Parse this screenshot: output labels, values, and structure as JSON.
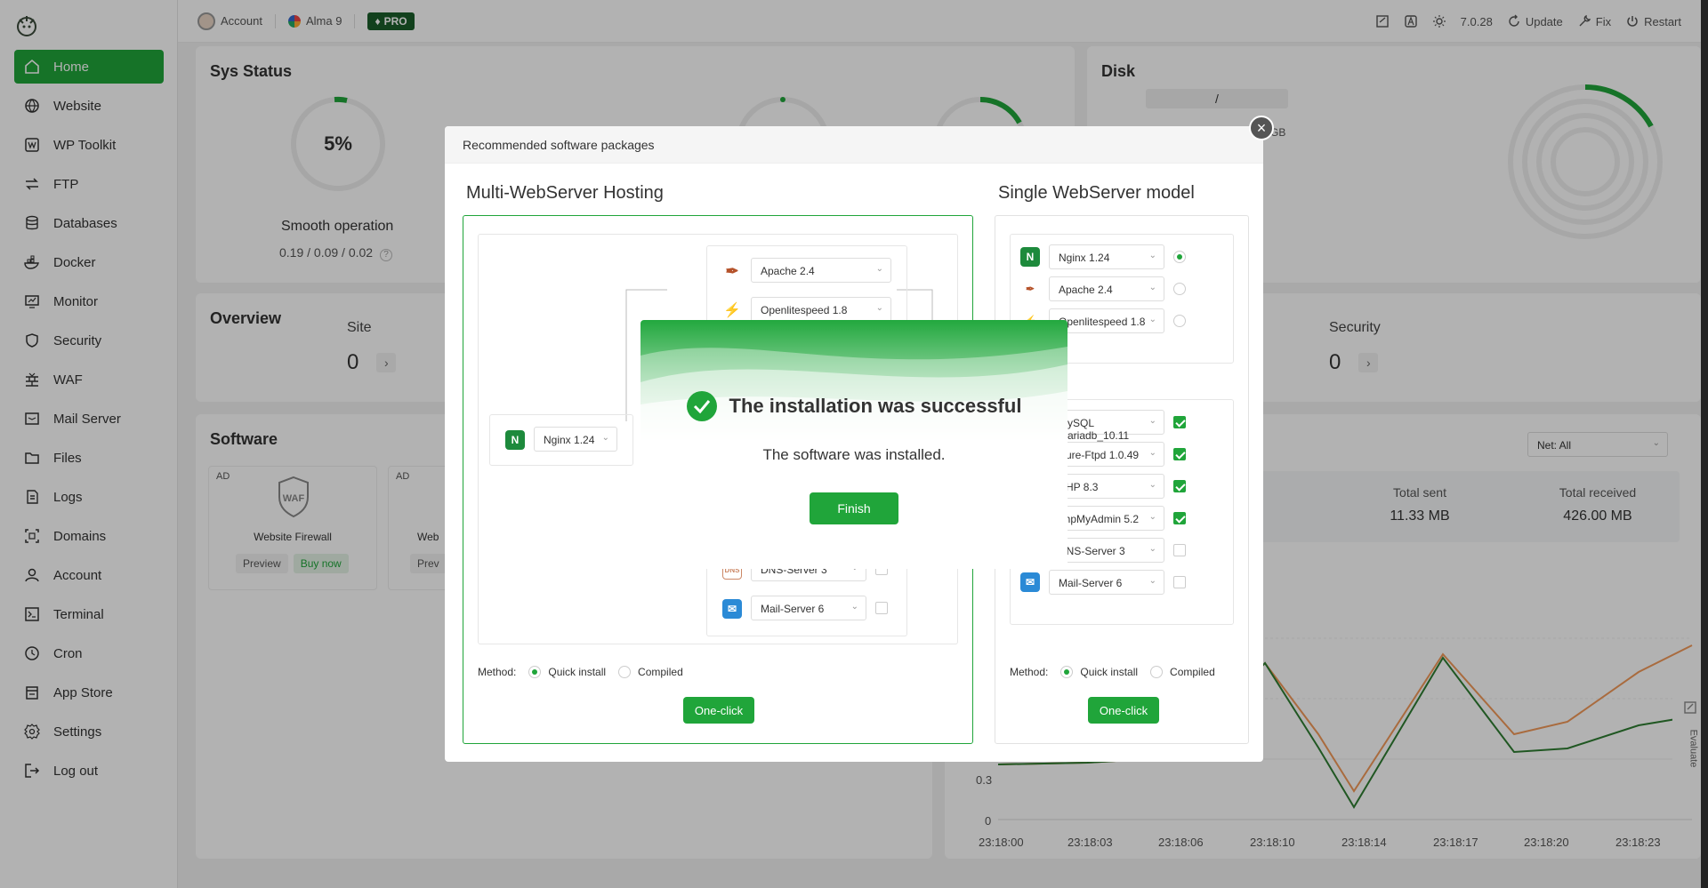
{
  "sidebar": {
    "items": [
      {
        "label": "Home",
        "icon": "home-icon",
        "active": true
      },
      {
        "label": "Website",
        "icon": "globe-icon"
      },
      {
        "label": "WP Toolkit",
        "icon": "wordpress-icon"
      },
      {
        "label": "FTP",
        "icon": "ftp-icon"
      },
      {
        "label": "Databases",
        "icon": "database-icon"
      },
      {
        "label": "Docker",
        "icon": "docker-icon"
      },
      {
        "label": "Monitor",
        "icon": "monitor-icon"
      },
      {
        "label": "Security",
        "icon": "shield-icon"
      },
      {
        "label": "WAF",
        "icon": "firewall-icon"
      },
      {
        "label": "Mail Server",
        "icon": "mail-icon"
      },
      {
        "label": "Files",
        "icon": "folder-icon"
      },
      {
        "label": "Logs",
        "icon": "log-icon"
      },
      {
        "label": "Domains",
        "icon": "domain-icon"
      },
      {
        "label": "Account",
        "icon": "user-icon"
      },
      {
        "label": "Terminal",
        "icon": "terminal-icon"
      },
      {
        "label": "Cron",
        "icon": "clock-icon"
      },
      {
        "label": "App Store",
        "icon": "store-icon"
      },
      {
        "label": "Settings",
        "icon": "gear-icon"
      },
      {
        "label": "Log out",
        "icon": "logout-icon"
      }
    ]
  },
  "topbar": {
    "account": "Account",
    "os": "Alma 9",
    "pro": "PRO",
    "version": "7.0.28",
    "update": "Update",
    "fix": "Fix",
    "restart": "Restart"
  },
  "sys_status": {
    "title": "Sys Status",
    "load_percent": "5%",
    "status": "Smooth operation",
    "load_avg": "0.19 / 0.09 / 0.02"
  },
  "disk": {
    "title": "Disk",
    "path": "/",
    "usage_unit": "GB"
  },
  "overview": {
    "title": "Overview",
    "site_label": "Site",
    "site_value": "0",
    "security_label": "Security",
    "security_value": "0"
  },
  "software": {
    "title": "Software",
    "cards": [
      {
        "ad": "AD",
        "name": "Website Firewall",
        "preview": "Preview",
        "buy": "Buy now"
      },
      {
        "ad": "AD",
        "name": "Web",
        "preview": "Prev"
      }
    ]
  },
  "traffic": {
    "net_select": "Net: All",
    "total_sent_label": "Total sent",
    "total_sent": "11.33 MB",
    "total_received_label": "Total received",
    "total_received": "426.00 MB",
    "y_ticks": [
      "0.3",
      "0"
    ],
    "x_ticks": [
      "23:18:00",
      "23:18:03",
      "23:18:06",
      "23:18:10",
      "23:18:14",
      "23:18:17",
      "23:18:20",
      "23:18:23"
    ]
  },
  "dialog": {
    "title": "Recommended software packages",
    "multi_title": "Multi-WebServer Hosting",
    "single_title": "Single WebServer model",
    "multi": {
      "nginx": "Nginx 1.24",
      "apache": "Apache 2.4",
      "ols": "Openlitespeed 1.8",
      "dns": "DNS-Server 3",
      "mail": "Mail-Server 6"
    },
    "single": {
      "servers": [
        {
          "label": "Nginx 1.24",
          "icon": "nginx-icon",
          "selected": true
        },
        {
          "label": "Apache 2.4",
          "icon": "apache-feather-icon",
          "selected": false
        },
        {
          "label": "Openlitespeed 1.8",
          "icon": "openlitespeed-icon",
          "selected": false
        }
      ],
      "packages": [
        {
          "label": "MySQL mariadb_10.11",
          "checked": true
        },
        {
          "label": "Pure-Ftpd 1.0.49",
          "checked": true
        },
        {
          "label": "PHP 8.3",
          "checked": true
        },
        {
          "label": "phpMyAdmin 5.2",
          "checked": true
        },
        {
          "label": "DNS-Server 3",
          "checked": false
        },
        {
          "label": "Mail-Server 6",
          "checked": false
        }
      ]
    },
    "method_label": "Method:",
    "quick_install": "Quick install",
    "compiled": "Compiled",
    "one_click": "One-click"
  },
  "success": {
    "title": "The installation was successful",
    "message": "The software was installed.",
    "finish": "Finish"
  },
  "evaluate": "Evaluate",
  "colors": {
    "accent": "#20a53a",
    "orange": "#f29a5a"
  }
}
